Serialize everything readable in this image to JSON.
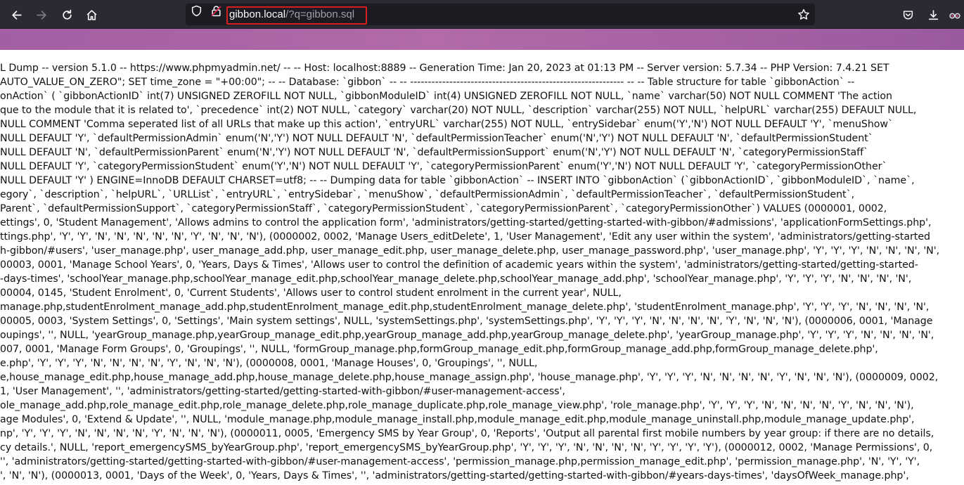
{
  "browser": {
    "url_host": "gibbon.local",
    "url_path": "/?q=gibbon.sql",
    "icons": {
      "back": "back-arrow-icon",
      "forward": "forward-arrow-icon",
      "reload": "reload-icon",
      "home": "home-icon",
      "tracking_protection": "shield-icon",
      "connection": "lock-icon",
      "bookmark": "star-icon",
      "pocket": "pocket-icon",
      "downloads": "download-icon",
      "extension": "extension-icon"
    },
    "colors": {
      "toolbar": "#2b2a33",
      "urlbar": "#1c1b22",
      "url_highlight": "#d42020",
      "banner": "#a862a6"
    }
  },
  "dump": {
    "lines": [
      "L Dump -- version 5.1.0 -- https://www.phpmyadmin.net/ -- -- Host: localhost:8889 -- Generation Time: Jan 20, 2023 at 01:13 PM -- Server version: 5.7.34 -- PHP Version: 7.4.21 SET",
      "AUTO_VALUE_ON_ZERO\"; SET time_zone = \"+00:00\"; -- -- Database: `gibbon` -- -- ------------------------------------------------------------ -- -- Table structure for table `gibbonAction` --",
      "onAction` ( `gibbonActionID` int(7) UNSIGNED ZEROFILL NOT NULL, `gibbonModuleID` int(4) UNSIGNED ZEROFILL NOT NULL, `name` varchar(50) NOT NULL COMMENT 'The action",
      "que to the module that it is related to', `precedence` int(2) NOT NULL, `category` varchar(20) NOT NULL, `description` varchar(255) NOT NULL, `helpURL` varchar(255) DEFAULT NULL,",
      "NULL COMMENT 'Comma seperated list of all URLs that make up this action', `entryURL` varchar(255) NOT NULL, `entrySidebar` enum('Y','N') NOT NULL DEFAULT 'Y', `menuShow`",
      "NULL DEFAULT 'Y', `defaultPermissionAdmin` enum('N','Y') NOT NULL DEFAULT 'N', `defaultPermissionTeacher` enum('N','Y') NOT NULL DEFAULT 'N', `defaultPermissionStudent`",
      "NULL DEFAULT 'N', `defaultPermissionParent` enum('N','Y') NOT NULL DEFAULT 'N', `defaultPermissionSupport` enum('N','Y') NOT NULL DEFAULT 'N', `categoryPermissionStaff`",
      "NULL DEFAULT 'Y', `categoryPermissionStudent` enum('Y','N') NOT NULL DEFAULT 'Y', `categoryPermissionParent` enum('Y','N') NOT NULL DEFAULT 'Y', `categoryPermissionOther`",
      "NULL DEFAULT 'Y' ) ENGINE=InnoDB DEFAULT CHARSET=utf8; -- -- Dumping data for table `gibbonAction` -- INSERT INTO `gibbonAction` (`gibbonActionID`, `gibbonModuleID`, `name`,",
      "egory`, `description`, `helpURL`, `URLList`, `entryURL`, `entrySidebar`, `menuShow`, `defaultPermissionAdmin`, `defaultPermissionTeacher`, `defaultPermissionStudent`,",
      "Parent`, `defaultPermissionSupport`, `categoryPermissionStaff`, `categoryPermissionStudent`, `categoryPermissionParent`, `categoryPermissionOther`) VALUES (0000001, 0002,",
      "ettings', 0, 'Student Management', 'Allows admins to control the application form', 'administrators/getting-started/getting-started-with-gibbon/#admissions', 'applicationFormSettings.php',",
      "ttings.php', 'Y', 'Y', 'N', 'N', 'N', 'N', 'N', 'Y', 'N', 'N', 'N'), (0000002, 0002, 'Manage Users_editDelete', 1, 'User Management', 'Edit any user within the system', 'administrators/getting-started",
      "h-gibbon/#users', 'user_manage.php', user_manage_add.php, user_manage_edit.php, user_manage_delete.php, user_manage_password.php', 'user_manage.php', 'Y', 'Y', 'Y', 'N', 'N', 'N', 'N',",
      "00003, 0001, 'Manage School Years', 0, 'Years, Days & Times', 'Allows user to control the definition of academic years within the system', 'administrators/getting-started/getting-started-",
      "-days-times', 'schoolYear_manage.php,schoolYear_manage_edit.php,schoolYear_manage_delete.php,schoolYear_manage_add.php', 'schoolYear_manage.php', 'Y', 'Y', 'Y', 'N', 'N', 'N', 'N',",
      "00004, 0145, 'Student Enrolment', 0, 'Current Students', 'Allows user to control student enrolment in the current year', NULL,",
      "manage.php,studentEnrolment_manage_add.php,studentEnrolment_manage_edit.php,studentEnrolment_manage_delete.php', 'studentEnrolment_manage.php', 'Y', 'Y', 'Y', 'N', 'N', 'N', 'N',",
      "00005, 0003, 'System Settings', 0, 'Settings', 'Main system settings', NULL, 'systemSettings.php', 'systemSettings.php', 'Y', 'Y', 'Y', 'N', 'N', 'N', 'N', 'Y', 'N', 'N', 'N'), (0000006, 0001, 'Manage",
      "oupings', '', NULL, 'yearGroup_manage.php,yearGroup_manage_edit.php,yearGroup_manage_add.php,yearGroup_manage_delete.php', 'yearGroup_manage.php', 'Y', 'Y', 'Y', 'N', 'N', 'N', 'N',",
      "007, 0001, 'Manage Form Groups', 0, 'Groupings', '', NULL, 'formGroup_manage.php,formGroup_manage_edit.php,formGroup_manage_add.php,formGroup_manage_delete.php',",
      "e.php', 'Y', 'Y', 'Y', 'N', 'N', 'N', 'N', 'Y', 'N', 'N', 'N'), (0000008, 0001, 'Manage Houses', 0, 'Groupings', '', NULL,",
      "e,house_manage_edit.php,house_manage_add.php,house_manage_delete.php,house_manage_assign.php', 'house_manage.php', 'Y', 'Y', 'Y', 'N', 'N', 'N', 'N', 'Y', 'N', 'N', 'N'), (0000009, 0002,",
      "1, 'User Management', '', 'administrators/getting-started/getting-started-with-gibbon/#user-management-access',",
      "ole_manage_add.php,role_manage_edit.php,role_manage_delete.php,role_manage_duplicate.php,role_manage_view.php', 'role_manage.php', 'Y', 'Y', 'Y', 'N', 'N', 'N', 'N', 'Y', 'N', 'N', 'N'),",
      "age Modules', 0, 'Extend & Update', '', NULL, 'module_manage.php,module_manage_install.php,module_manage_edit.php,module_manage_uninstall.php,module_manage_update.php',",
      "np', 'Y', 'Y', 'Y', 'N', 'N', 'N', 'N', 'Y', 'N', 'N', 'N'), (0000011, 0005, 'Emergency SMS by Year Group', 0, 'Reports', 'Output all parental first mobile numbers by year group: if there are no details,",
      "cy details.', NULL, 'report_emergencySMS_byYearGroup.php', 'report_emergencySMS_byYearGroup.php', 'Y', 'Y', 'Y', 'N', 'N', 'N', 'N', 'Y', 'Y', 'Y', 'Y'), (0000012, 0002, 'Manage Permissions', 0,",
      "'', 'administrators/getting-started/getting-started-with-gibbon/#user-management-access', 'permission_manage.php,permission_manage_edit.php', 'permission_manage.php', 'N', 'Y', 'Y',",
      "', 'N', 'N'), (0000013, 0001, 'Days of the Week', 0, 'Years, Days & Times', '', 'administrators/getting-started/getting-started-with-gibbon/#years-days-times', 'daysOfWeek_manage.php',"
    ]
  }
}
